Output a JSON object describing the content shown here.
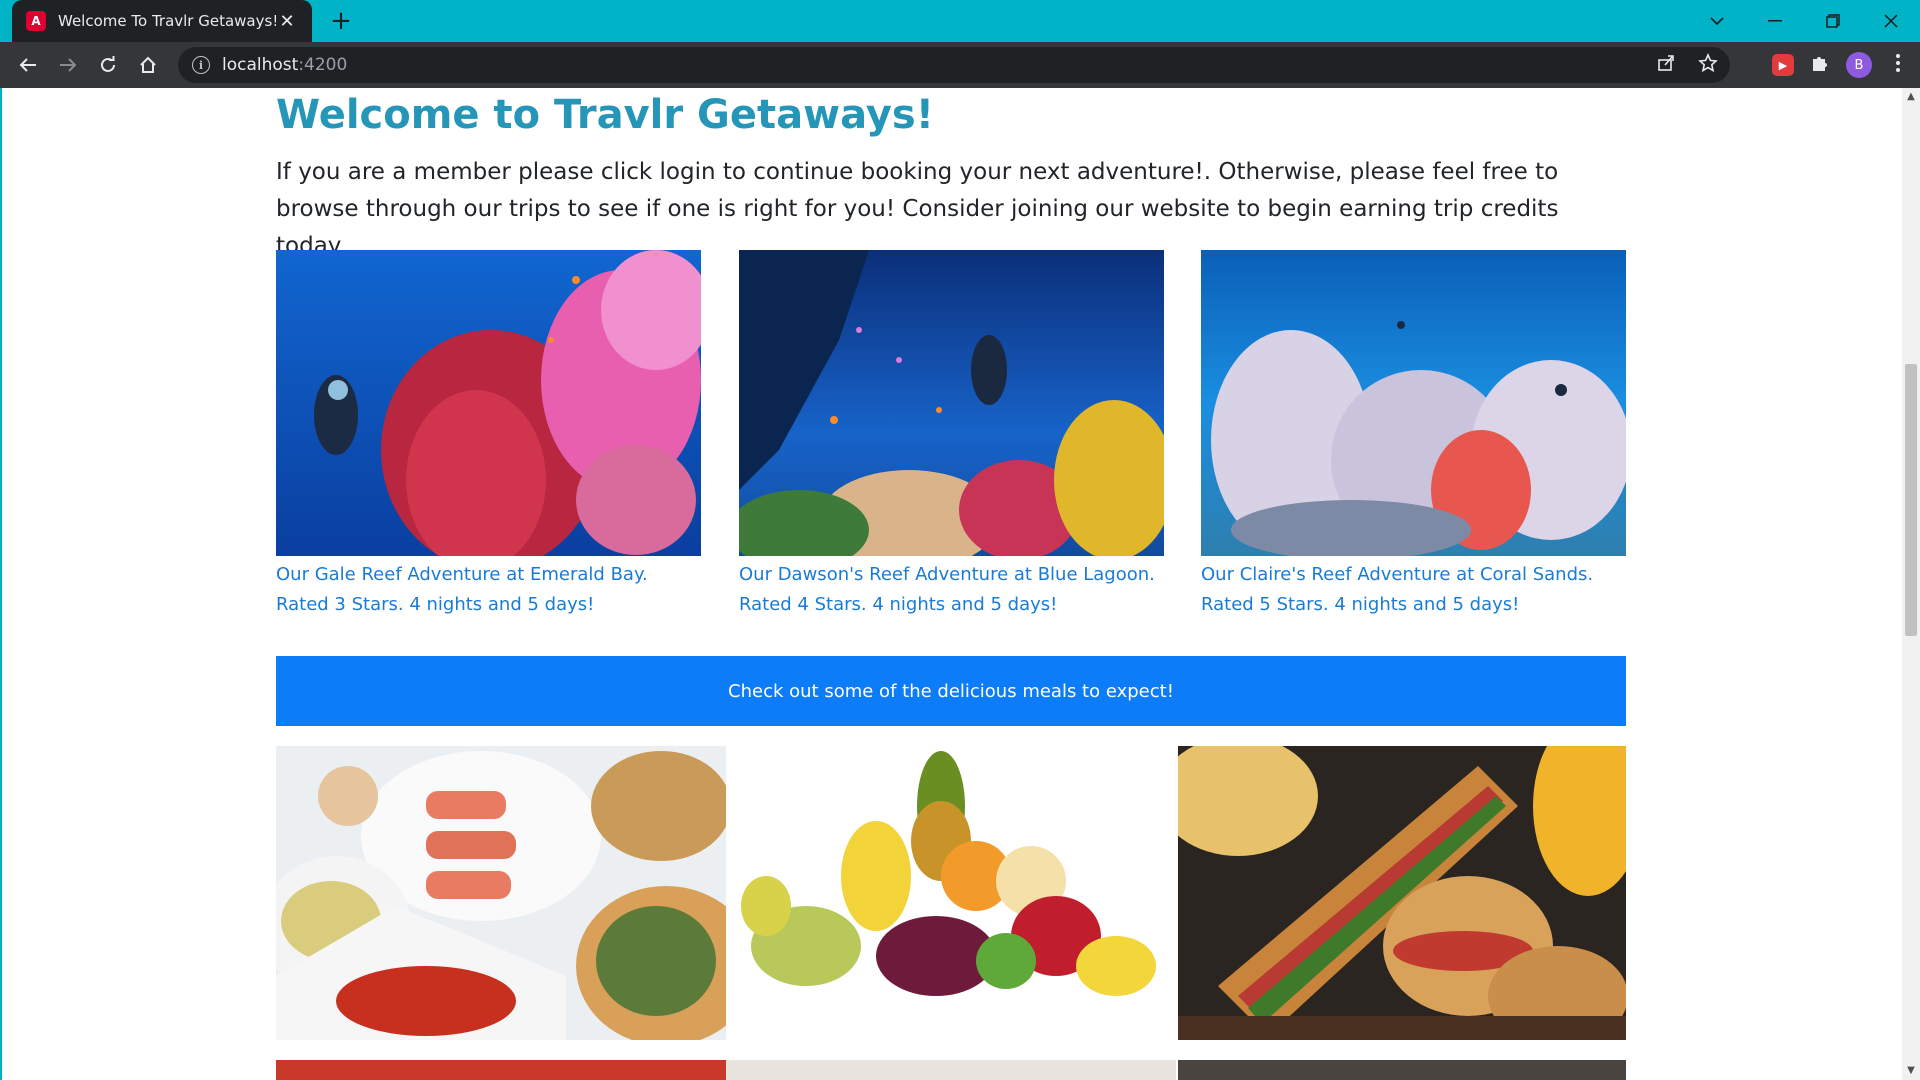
{
  "browser": {
    "tab_title": "Welcome To Travlr Getaways!",
    "tab_favicon": "A",
    "tab_close": "✕",
    "new_tab": "+",
    "url_host": "localhost",
    "url_port": ":4200",
    "profile_initial": "B"
  },
  "page": {
    "title": "Welcome to Travlr Getaways!",
    "intro": "If you are a member please click login to continue booking your next adventure!. Otherwise, please feel free to browse through our trips to see if one is right for you! Consider joining our website to begin earning trip credits today."
  },
  "trips": [
    {
      "caption": "Our Gale Reef Adventure at Emerald Bay. Rated 3 Stars. 4 nights and 5 days!"
    },
    {
      "caption": "Our Dawson's Reef Adventure at Blue Lagoon. Rated 4 Stars. 4 nights and 5 days!"
    },
    {
      "caption": "Our Claire's Reef Adventure at Coral Sands. Rated 5 Stars. 4 nights and 5 days!"
    }
  ],
  "meals": {
    "banner": "Check out some of the delicious meals to expect!"
  },
  "colors": {
    "chrome_accent": "#00b3c7",
    "title": "#2596b8",
    "link": "#1a7bd6",
    "banner": "#0d7cf8"
  },
  "icons": [
    "back-icon",
    "forward-icon",
    "reload-icon",
    "home-icon",
    "info-icon",
    "share-icon",
    "star-icon",
    "extension-icon",
    "puzzle-icon",
    "menu-icon"
  ]
}
